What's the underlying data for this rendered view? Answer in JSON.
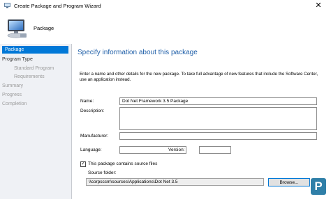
{
  "window": {
    "title": "Create Package and Program Wizard",
    "close_glyph": "✕"
  },
  "header": {
    "title": "Package",
    "icon": "computer-icon"
  },
  "sidebar": {
    "items": [
      {
        "label": "Package",
        "state": "active"
      },
      {
        "label": "Program Type",
        "state": "bold"
      },
      {
        "label": "Standard Program",
        "state": "sub"
      },
      {
        "label": "Requirements",
        "state": "sub"
      },
      {
        "label": "Summary",
        "state": "normal"
      },
      {
        "label": "Progress",
        "state": "normal"
      },
      {
        "label": "Completion",
        "state": "normal"
      }
    ]
  },
  "main": {
    "heading": "Specify information about this package",
    "intro": "Enter a name and other details for the new package. To take full advantage of new features that include the Software Center, use an application instead.",
    "name_label": "Name:",
    "name_value": "Dot Net Framework 3.5 Package",
    "description_label": "Description:",
    "description_value": "",
    "manufacturer_label": "Manufacturer:",
    "manufacturer_value": "",
    "language_label": "Language:",
    "language_value": "",
    "version_label": "Version:",
    "version_value": "",
    "source_checkbox_label": "This package contains source files",
    "source_checked": true,
    "check_glyph": "✓",
    "source_folder_label": "Source folder:",
    "source_folder_value": "\\\\corpsccm\\sources\\Applications\\Dot Net 3.5",
    "browse_label": "Browse..."
  },
  "logo": {
    "glyph": "P"
  },
  "colors": {
    "accent": "#0078d7",
    "heading": "#1f5fa8",
    "sidebar_bg": "#eff1f5",
    "logo": "#2f7fa8"
  }
}
